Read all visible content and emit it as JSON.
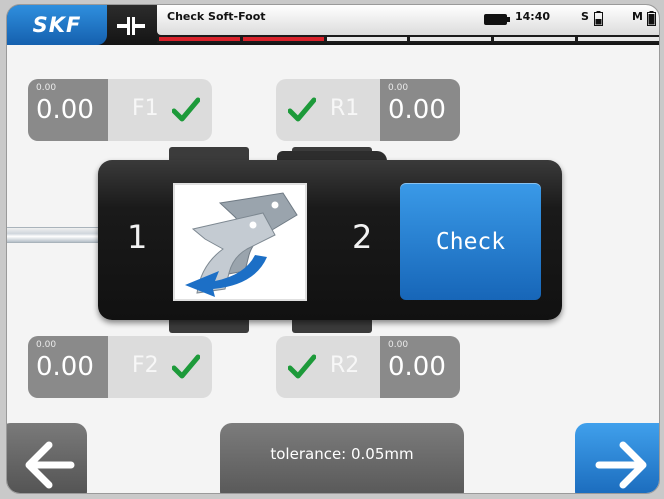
{
  "header": {
    "logo": "SKF",
    "title": "Check Soft-Foot",
    "time": "14:40",
    "sensor_s": "S",
    "sensor_m": "M",
    "progress_steps": [
      true,
      true,
      false,
      false,
      false,
      false
    ]
  },
  "machine": {
    "left_label": "1",
    "right_label": "2",
    "check_label": "Check"
  },
  "feet": {
    "F1": {
      "name": "F1",
      "small": "0.00",
      "value": "0.00",
      "ok": true
    },
    "R1": {
      "name": "R1",
      "small": "0.00",
      "value": "0.00",
      "ok": true
    },
    "F2": {
      "name": "F2",
      "small": "0.00",
      "value": "0.00",
      "ok": true
    },
    "R2": {
      "name": "R2",
      "small": "0.00",
      "value": "0.00",
      "ok": true
    }
  },
  "footer": {
    "tolerance": "tolerance: 0.05mm"
  },
  "colors": {
    "accent_blue": "#1f7fd4",
    "check_green": "#1d9a3a",
    "progress_red": "#d8222b"
  },
  "icons": [
    "coupling-icon",
    "battery-icon",
    "checkmark-icon",
    "back-arrow-icon",
    "forward-arrow-icon",
    "soft-foot-shim-icon"
  ]
}
